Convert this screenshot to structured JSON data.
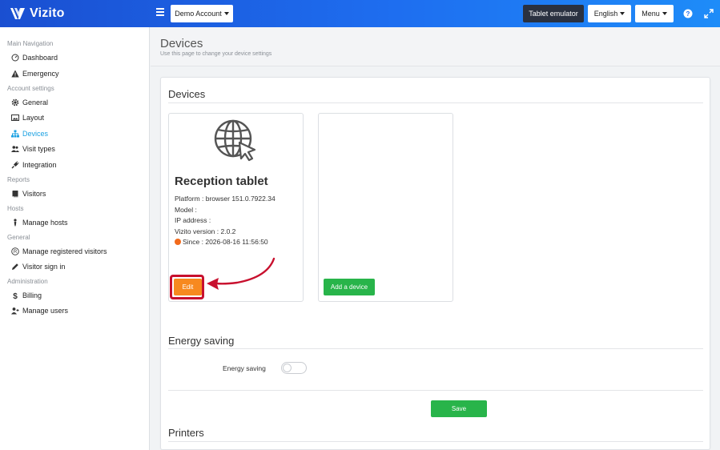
{
  "app": {
    "name": "Vizito"
  },
  "topbar": {
    "account_label": "Demo Account",
    "tablet_emulator_label": "Tablet emulator",
    "language_label": "English",
    "menu_label": "Menu"
  },
  "sidebar": {
    "sections": [
      {
        "title": "Main Navigation",
        "items": [
          {
            "label": "Dashboard",
            "icon": "dashboard-icon"
          },
          {
            "label": "Emergency",
            "icon": "warning-icon"
          }
        ]
      },
      {
        "title": "Account settings",
        "items": [
          {
            "label": "General",
            "icon": "gear-icon"
          },
          {
            "label": "Layout",
            "icon": "image-icon"
          },
          {
            "label": "Devices",
            "icon": "sitemap-icon",
            "active": true
          },
          {
            "label": "Visit types",
            "icon": "users-icon"
          },
          {
            "label": "Integration",
            "icon": "plug-icon"
          }
        ]
      },
      {
        "title": "Reports",
        "items": [
          {
            "label": "Visitors",
            "icon": "book-icon"
          }
        ]
      },
      {
        "title": "Hosts",
        "items": [
          {
            "label": "Manage hosts",
            "icon": "person-icon"
          }
        ]
      },
      {
        "title": "General",
        "items": [
          {
            "label": "Manage registered visitors",
            "icon": "registered-icon"
          },
          {
            "label": "Visitor sign in",
            "icon": "pencil-icon"
          }
        ]
      },
      {
        "title": "Administration",
        "items": [
          {
            "label": "Billing",
            "icon": "dollar-icon"
          },
          {
            "label": "Manage users",
            "icon": "user-plus-icon"
          }
        ]
      }
    ]
  },
  "header": {
    "title": "Devices",
    "subtitle": "Use this page to change your device settings"
  },
  "devices_section": {
    "title": "Devices",
    "device": {
      "name": "Reception tablet",
      "platform": "Platform : browser 151.0.7922.34",
      "model": "Model :",
      "ip_address": "IP address :",
      "version": "Vizito version : 2.0.2",
      "since": "Since : 2026-08-16 11:56:50",
      "status_color": "#f26a1b",
      "edit_label": "Edit"
    },
    "add_device_label": "Add a device"
  },
  "energy_section": {
    "title": "Energy saving",
    "toggle_label": "Energy saving",
    "toggle_on": false,
    "save_label": "Save"
  },
  "printers_section": {
    "title": "Printers"
  },
  "colors": {
    "topbar": "#1e6ef0",
    "active_nav": "#1ba1e2",
    "edit_button": "#f7891f",
    "success_button": "#28b44a",
    "highlight": "#c8102e"
  }
}
